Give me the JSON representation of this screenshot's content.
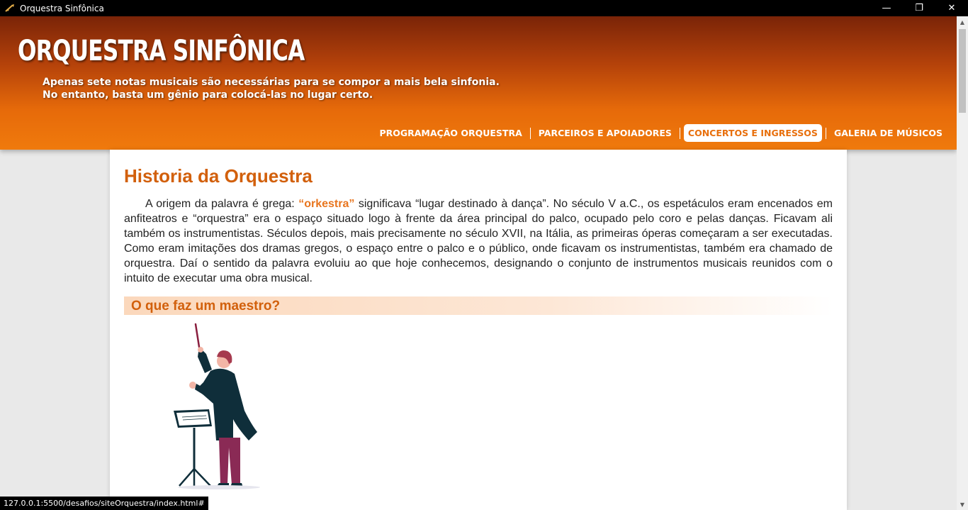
{
  "window": {
    "title": "Orquestra Sinfônica",
    "controls": {
      "minimize": "—",
      "restore": "❐",
      "close": "✕"
    }
  },
  "header": {
    "title": "ORQUESTRA SINFÔNICA",
    "tagline_line1": "Apenas sete notas musicais são necessárias para se compor a mais bela sinfonia.",
    "tagline_line2": "No entanto, basta um gênio para colocá-las no lugar certo.",
    "nav": [
      {
        "label": "PROGRAMAÇÃO ORQUESTRA",
        "active": false
      },
      {
        "label": "PARCEIROS E APOIADORES",
        "active": false
      },
      {
        "label": "CONCERTOS E INGRESSOS",
        "active": true
      },
      {
        "label": "GALERIA DE MÚSICOS",
        "active": false
      }
    ]
  },
  "main": {
    "title": "Historia da Orquestra",
    "paragraph_before": "A origem da palavra é grega: ",
    "paragraph_highlight": "“orkestra”",
    "paragraph_after": " significava “lugar destinado à dança”. No século V a.C., os espetáculos eram encenados em anfiteatros e “orquestra” era o espaço situado logo à frente da área principal do palco, ocupado pelo coro e pelas danças. Ficavam ali também os instrumentistas. Séculos depois, mais precisamente no século XVII, na Itália, as primeiras óperas começaram a ser executadas. Como eram imitações dos dramas gregos, o espaço entre o palco e o público, onde ficavam os instrumentistas, também era chamado de orquestra. Daí o sentido da palavra evoluiu ao que hoje conhecemos, designando o conjunto de instrumentos musicais reunidos com o intuito de executar uma obra musical.",
    "subheading": "O que faz um maestro?",
    "illustration_icon": "conductor-illustration"
  },
  "status": {
    "url": "127.0.0.1:5500/desafios/siteOrquestra/index.html#"
  },
  "colors": {
    "accent": "#d2600c",
    "highlight": "#e8751e",
    "header_dark": "#7a2408",
    "header_light": "#f07a0c"
  }
}
